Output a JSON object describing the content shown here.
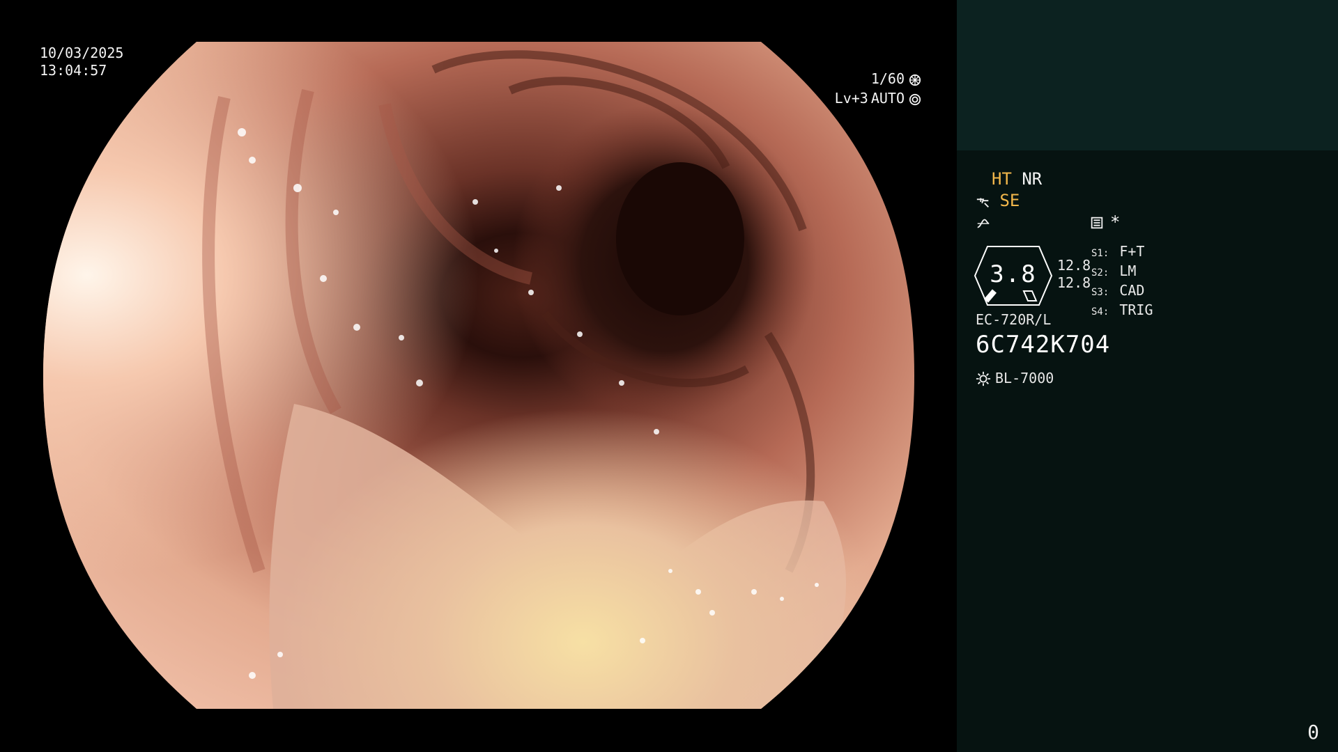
{
  "overlay": {
    "date": "10/03/2025",
    "time": "13:04:57",
    "shutter": "1/60",
    "shutter_icon": "shutter-icon",
    "level": "Lv+3",
    "mode": "AUTO",
    "auto_icon": "auto-exposure-icon"
  },
  "panel": {
    "ht_label": "HT",
    "nr_label": "NR",
    "se_label": "SE",
    "star_label": "*",
    "badge_value": "3.8",
    "side_values": [
      "12.8",
      "12.8"
    ],
    "modes": [
      {
        "key": "S1:",
        "value": "F+T"
      },
      {
        "key": "S2:",
        "value": "LM"
      },
      {
        "key": "S3:",
        "value": "CAD"
      },
      {
        "key": "S4:",
        "value": "TRIG"
      }
    ],
    "model": "EC-720R/L",
    "serial": "6C742K704",
    "light_source": "BL-7000",
    "counter": "0"
  },
  "colors": {
    "panel_bg": "#061311",
    "panel_top": "#0c2220",
    "accent": "#f2b74b"
  }
}
